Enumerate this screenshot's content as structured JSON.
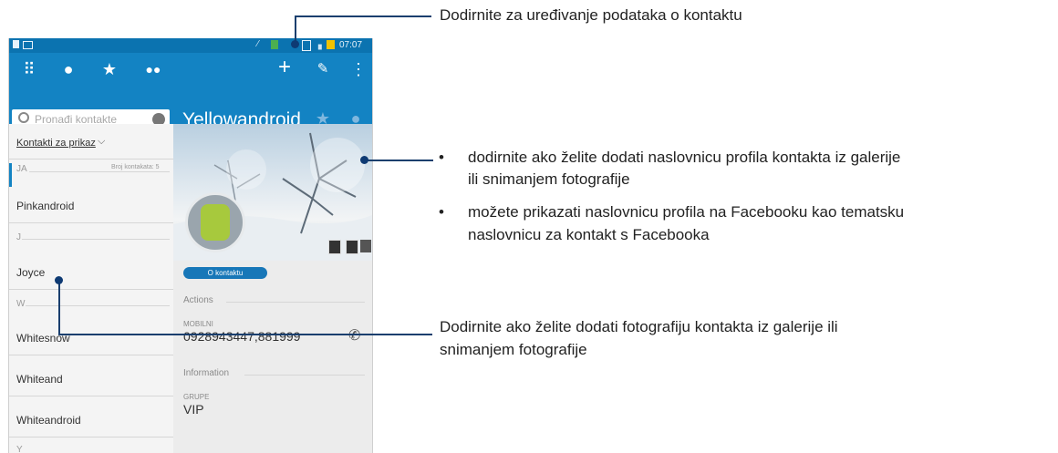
{
  "status_bar": {
    "time": "07:07"
  },
  "toolbar": {
    "search_placeholder": "Pronađi kontakte",
    "contact_name": "Yellowandroid"
  },
  "contact_list": {
    "filter_label": "Kontakti za prikaz",
    "count_label": "Broj kontakata: 5",
    "sections": {
      "ja": "JA",
      "j": "J",
      "w": "W",
      "y": "Y"
    },
    "items": [
      "Pinkandroid",
      "Joyce",
      "Whitesnow",
      "Whiteand",
      "Whiteandroid"
    ]
  },
  "details": {
    "about_button": "O kontaktu",
    "actions_label": "Actions",
    "mobile_label": "MOBILNI",
    "mobile_value": "0928943447,881999",
    "information_label": "Information",
    "group_label": "GRUPE",
    "group_value": "VIP"
  },
  "annotations": {
    "edit": "Dodirnite za uređivanje podataka o kontaktu",
    "cover_bullet_1_line_1": "dodirnite ako želite dodati naslovnicu profila kontakta iz galerije",
    "cover_bullet_1_line_2": "ili snimanjem fotografije",
    "cover_bullet_2_line_1": "možete prikazati naslovnicu profila na Facebooku kao tematsku",
    "cover_bullet_2_line_2": "naslovnicu za kontakt s Facebooka",
    "photo_line_1": "Dodirnite ako želite dodati fotografiju kontakta iz galerije ili",
    "photo_line_2": "snimanjem fotografije"
  },
  "colors": {
    "toolbar": "#1383c3",
    "status_bar": "#0b73b0",
    "accent_button": "#1877b8",
    "callout_line": "#1a3f6e"
  }
}
